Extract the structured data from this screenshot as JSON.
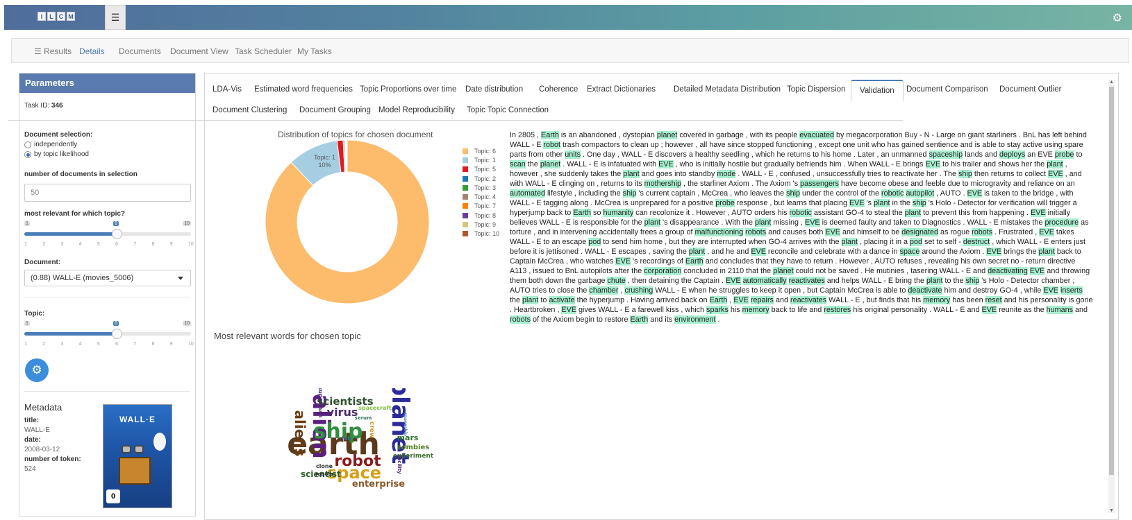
{
  "header": {
    "logo_letters": [
      "I",
      "L",
      "C",
      "M"
    ],
    "menu_icon": "hamburger-icon",
    "settings_icon": "gear-icon"
  },
  "nav": [
    "Results",
    "Details",
    "Documents",
    "Document View",
    "Task Scheduler",
    "My Tasks"
  ],
  "sidebar": {
    "title": "Parameters",
    "task_id_label": "Task ID:",
    "task_id": "346",
    "doc_selection_label": "Document selection:",
    "radio_options": [
      "independently",
      "by topic likelihood"
    ],
    "ndocs_label": "number of documents in selection",
    "ndocs_value": "50",
    "relevant_topic_label": "most relevant for which topic?",
    "slider1": {
      "min": "1",
      "max": "10",
      "value": "6",
      "ticks": [
        "1",
        "2",
        "3",
        "4",
        "5",
        "6",
        "7",
        "8",
        "9",
        "10"
      ]
    },
    "document_label": "Document:",
    "document_value": "(0.88) WALL-E (movies_5006)",
    "topic_label": "Topic:",
    "slider2": {
      "min": "1",
      "max": "10",
      "value": "6",
      "ticks": [
        "1",
        "2",
        "3",
        "4",
        "5",
        "6",
        "7",
        "8",
        "9",
        "10"
      ]
    },
    "metadata_title": "Metadata",
    "meta_title_label": "title:",
    "meta_title": "WALL-E",
    "meta_date_label": "date:",
    "meta_date": "2008-03-12",
    "meta_tokens_label": "number of token:",
    "meta_tokens": "524",
    "poster_title": "WALL·E",
    "poster_rating": "0"
  },
  "tabs_row1": [
    "LDA-Vis",
    "Estimated word frequencies",
    "Topic Proportions over time",
    "Date distribution",
    "Coherence",
    "Extract Dictionaries",
    "Detailed Metadata Distribution",
    "Topic Dispersion",
    "Validation",
    "Document Comparison",
    "Document Outlier"
  ],
  "tabs_row2": [
    "Document Clustering",
    "Document Grouping",
    "Model Reproducibility",
    "Topic Topic Connection"
  ],
  "active_tab": "Validation",
  "chart_title": "Distribution of topics for chosen document",
  "words_title": "Most relevant words for chosen topic",
  "chart_data": {
    "type": "pie",
    "donut": true,
    "title": "Distribution of topics for chosen document",
    "categories": [
      "Topic: 6",
      "Topic: 1",
      "Topic: 5",
      "Topic: 2",
      "Topic: 3",
      "Topic: 4",
      "Topic: 7",
      "Topic: 8",
      "Topic: 9",
      "Topic: 10"
    ],
    "values": [
      88,
      10,
      1.2,
      0.2,
      0.2,
      0.1,
      0.1,
      0.1,
      0.05,
      0.05
    ],
    "colors": [
      "#fdbb6c",
      "#a6cee3",
      "#e31a1c",
      "#1f78b4",
      "#33a02c",
      "#a6836f",
      "#ff7f00",
      "#6a3d9a",
      "#d2c87a",
      "#b15928"
    ],
    "slice_label": {
      "name": "Topic: 1",
      "value": "10%"
    },
    "legend": "right"
  },
  "document_text_segments": [
    [
      "In 2805 , ",
      0
    ],
    [
      "Earth",
      1
    ],
    [
      " is an ",
      0
    ],
    [
      "abandoned",
      0
    ],
    [
      " , dystopian ",
      0
    ],
    [
      "planet",
      1
    ],
    [
      " covered in garbage , with its people ",
      0
    ],
    [
      "evacuated",
      1
    ],
    [
      " by megacorporation Buy - N - Large on giant starliners . BnL has left behind WALL - E ",
      0
    ],
    [
      "robot",
      1
    ],
    [
      " trash compactors to clean up ; however , all have since stopped functioning , except one unit who has gained sentience and is able to stay active using spare parts from other ",
      0
    ],
    [
      "units",
      1
    ],
    [
      " . One day , WALL - E discovers a healthy seedling , which he returns to his home . Later , an unmanned ",
      0
    ],
    [
      "spaceship",
      1
    ],
    [
      " lands and ",
      0
    ],
    [
      "deploys",
      1
    ],
    [
      " an EVE ",
      0
    ],
    [
      "probe",
      1
    ],
    [
      " to ",
      0
    ],
    [
      "scan",
      1
    ],
    [
      " the ",
      0
    ],
    [
      "planet",
      1
    ],
    [
      " . WALL - E is infatuated with ",
      0
    ],
    [
      "EVE",
      1
    ],
    [
      " , who is initially hostile but gradually befriends him . When WALL - E brings ",
      0
    ],
    [
      "EVE",
      1
    ],
    [
      " to his trailer and shows her the ",
      0
    ],
    [
      "plant",
      1
    ],
    [
      " , however , she suddenly takes the ",
      0
    ],
    [
      "plant",
      1
    ],
    [
      " and goes into standby ",
      0
    ],
    [
      "mode",
      1
    ],
    [
      " . WALL - E , confused , unsuccessfully tries to reactivate her . The ",
      0
    ],
    [
      "ship",
      1
    ],
    [
      " then returns to collect ",
      0
    ],
    [
      "EVE",
      1
    ],
    [
      " , and with WALL - E clinging on , returns to its ",
      0
    ],
    [
      "mothership",
      1
    ],
    [
      " , the starliner Axiom . The Axiom 's ",
      0
    ],
    [
      "passengers",
      1
    ],
    [
      " have become obese and feeble due to microgravity and reliance on an ",
      0
    ],
    [
      "automated",
      1
    ],
    [
      " lifestyle , including the ",
      0
    ],
    [
      "ship",
      1
    ],
    [
      " 's current captain , McCrea , who leaves the ",
      0
    ],
    [
      "ship",
      1
    ],
    [
      " under the control of the ",
      0
    ],
    [
      "robotic",
      1
    ],
    [
      " ",
      0
    ],
    [
      "autopilot",
      1
    ],
    [
      " , AUTO . ",
      0
    ],
    [
      "EVE",
      1
    ],
    [
      " is taken to the bridge , with WALL - E tagging along . McCrea is unprepared for a positive ",
      0
    ],
    [
      "probe",
      1
    ],
    [
      " response , but learns that placing ",
      0
    ],
    [
      "EVE",
      1
    ],
    [
      " 's ",
      0
    ],
    [
      "plant",
      1
    ],
    [
      " in the ",
      0
    ],
    [
      "ship",
      1
    ],
    [
      " 's Holo - Detector for verification will trigger a hyperjump back to ",
      0
    ],
    [
      "Earth",
      1
    ],
    [
      " so ",
      0
    ],
    [
      "humanity",
      1
    ],
    [
      " can recolonize it . However , AUTO orders his ",
      0
    ],
    [
      "robotic",
      1
    ],
    [
      " assistant GO-4 to steal the ",
      0
    ],
    [
      "plant",
      1
    ],
    [
      " to prevent this from happening . ",
      0
    ],
    [
      "EVE",
      1
    ],
    [
      " initially believes WALL - E is responsible for the ",
      0
    ],
    [
      "plant",
      1
    ],
    [
      " 's disappearance . With the ",
      0
    ],
    [
      "plant",
      1
    ],
    [
      " missing , ",
      0
    ],
    [
      "EVE",
      1
    ],
    [
      " is deemed faulty and taken to Diagnostics . WALL - E mistakes the ",
      0
    ],
    [
      "procedure",
      1
    ],
    [
      " as torture , and in intervening accidentally frees a group of ",
      0
    ],
    [
      "malfunctioning",
      1
    ],
    [
      " ",
      0
    ],
    [
      "robots",
      1
    ],
    [
      " and causes both ",
      0
    ],
    [
      "EVE",
      1
    ],
    [
      " and himself to be ",
      0
    ],
    [
      "designated",
      1
    ],
    [
      " as rogue ",
      0
    ],
    [
      "robots",
      1
    ],
    [
      " . Frustrated , ",
      0
    ],
    [
      "EVE",
      1
    ],
    [
      " takes WALL - E to an escape ",
      0
    ],
    [
      "pod",
      1
    ],
    [
      " to send him home , but they are interrupted when GO-4 arrives with the ",
      0
    ],
    [
      "plant",
      1
    ],
    [
      " , placing it in a ",
      0
    ],
    [
      "pod",
      1
    ],
    [
      " set to self - ",
      0
    ],
    [
      "destruct",
      1
    ],
    [
      " , which WALL - E enters just before it is jettisoned . WALL - E escapes , saving the ",
      0
    ],
    [
      "plant",
      1
    ],
    [
      " , and he and ",
      0
    ],
    [
      "EVE",
      1
    ],
    [
      " reconcile and celebrate with a dance in ",
      0
    ],
    [
      "space",
      1
    ],
    [
      " around the Axiom . ",
      0
    ],
    [
      "EVE",
      1
    ],
    [
      " brings the ",
      0
    ],
    [
      "plant",
      1
    ],
    [
      " back to Captain McCrea , who watches ",
      0
    ],
    [
      "EVE",
      1
    ],
    [
      " 's recordings of ",
      0
    ],
    [
      "Earth",
      1
    ],
    [
      " and concludes that they have to return . However , AUTO refuses , revealing his own secret no - return directive A113 , issued to BnL autopilots after the ",
      0
    ],
    [
      "corporation",
      1
    ],
    [
      " concluded in 2110 that the ",
      0
    ],
    [
      "planet",
      1
    ],
    [
      " could not be saved . He mutinies , tasering WALL - E and ",
      0
    ],
    [
      "deactivating",
      1
    ],
    [
      " ",
      0
    ],
    [
      "EVE",
      1
    ],
    [
      " and throwing them both down the garbage ",
      0
    ],
    [
      "chute",
      1
    ],
    [
      " , then detaining the Captain . ",
      0
    ],
    [
      "EVE",
      1
    ],
    [
      " ",
      0
    ],
    [
      "automatically",
      1
    ],
    [
      " ",
      0
    ],
    [
      "reactivates",
      1
    ],
    [
      " and helps WALL - E bring the ",
      0
    ],
    [
      "plant",
      1
    ],
    [
      " to the ",
      0
    ],
    [
      "ship",
      1
    ],
    [
      " 's Holo - Detector chamber ; AUTO tries to close the ",
      0
    ],
    [
      "chamber",
      1
    ],
    [
      " , ",
      0
    ],
    [
      "crushing",
      1
    ],
    [
      " WALL - E when he struggles to keep it open , but Captain McCrea is able to ",
      0
    ],
    [
      "deactivate",
      1
    ],
    [
      " him and destroy GO-4 , while ",
      0
    ],
    [
      "EVE",
      1
    ],
    [
      " ",
      0
    ],
    [
      "inserts",
      1
    ],
    [
      " the ",
      0
    ],
    [
      "plant",
      1
    ],
    [
      " to ",
      0
    ],
    [
      "activate",
      1
    ],
    [
      " the hyperjump . Having arrived back on ",
      0
    ],
    [
      "Earth",
      1
    ],
    [
      " , ",
      0
    ],
    [
      "EVE",
      1
    ],
    [
      " ",
      0
    ],
    [
      "repairs",
      1
    ],
    [
      " and ",
      0
    ],
    [
      "reactivates",
      1
    ],
    [
      " WALL - E , but finds that his ",
      0
    ],
    [
      "memory",
      1
    ],
    [
      " has been ",
      0
    ],
    [
      "reset",
      1
    ],
    [
      " and his personality is gone . Heartbroken , ",
      0
    ],
    [
      "EVE",
      1
    ],
    [
      " gives WALL - E a farewell kiss , which ",
      0
    ],
    [
      "sparks",
      1
    ],
    [
      " his ",
      0
    ],
    [
      "memory",
      1
    ],
    [
      " back to life and ",
      0
    ],
    [
      "restores",
      1
    ],
    [
      " his original personality . WALL - E and ",
      0
    ],
    [
      "EVE",
      1
    ],
    [
      " reunite as the ",
      0
    ],
    [
      "humans",
      1
    ],
    [
      " and ",
      0
    ],
    [
      "robots",
      1
    ],
    [
      " of the Axiom begin to restore ",
      0
    ],
    [
      "Earth",
      1
    ],
    [
      " and its ",
      0
    ],
    [
      "environment",
      1
    ],
    [
      " .",
      0
    ]
  ],
  "wordcloud": [
    {
      "w": "earth",
      "c": "#5a3a1a"
    },
    {
      "w": "planet",
      "c": "#2b2b9a"
    },
    {
      "w": "alien",
      "c": "#5b1f80"
    },
    {
      "w": "ship",
      "c": "#2f8f3f"
    },
    {
      "w": "space",
      "c": "#d4a017"
    },
    {
      "w": "robot",
      "c": "#8a1c1c"
    },
    {
      "w": "aliens",
      "c": "#6b3d14"
    },
    {
      "w": "scientists",
      "c": "#2f4f2f"
    },
    {
      "w": "virus",
      "c": "#4b2a6e"
    },
    {
      "w": "enterprise",
      "c": "#8a5a2b"
    },
    {
      "w": "scientist",
      "c": "#2e5e2e"
    },
    {
      "w": "mars",
      "c": "#2d6e2d"
    },
    {
      "w": "zombies",
      "c": "#4f7f1f"
    },
    {
      "w": "experiment",
      "c": "#3f6f2f"
    },
    {
      "w": "crew",
      "c": "#c69a2a"
    },
    {
      "w": "spacecraft",
      "c": "#7fbf3f"
    },
    {
      "w": "clone",
      "c": "#333"
    },
    {
      "w": "robots",
      "c": "#333"
    },
    {
      "w": "lab",
      "c": "#3a6a8a"
    },
    {
      "w": "superman",
      "c": "#4b2a6e"
    },
    {
      "w": "serum",
      "c": "#2e6e5e"
    },
    {
      "w": "facility",
      "c": "#4b2a6e"
    },
    {
      "w": "spaceship",
      "c": "#5a8aca"
    }
  ]
}
